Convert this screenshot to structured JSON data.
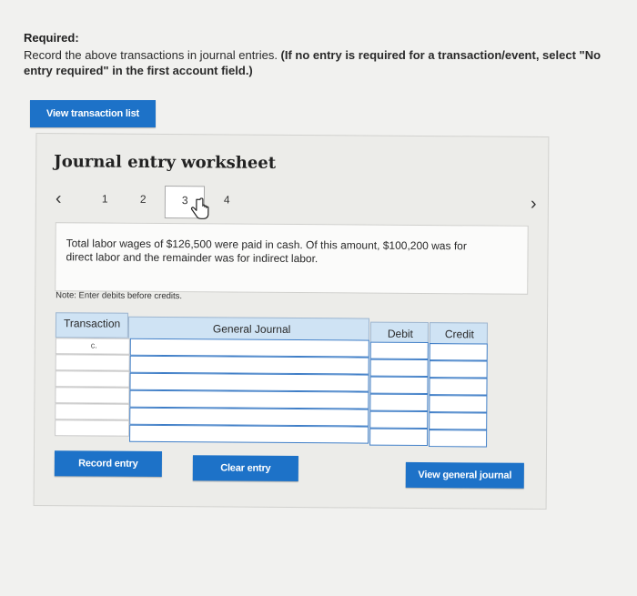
{
  "required": {
    "heading": "Required:",
    "line1_plain": "Record the above transactions in journal entries. ",
    "line1_bold": "(If no entry is required for a transaction/event, select \"No",
    "line2_bold": "entry required\" in the first account field.)"
  },
  "buttons": {
    "view_transaction_list": "View transaction list",
    "record_entry": "Record entry",
    "clear_entry": "Clear entry",
    "view_general_journal": "View general journal"
  },
  "worksheet": {
    "title": "Journal entry worksheet",
    "pager": {
      "prev_icon": "chevron-left-icon",
      "next_icon": "chevron-right-icon",
      "pages": [
        "1",
        "2",
        "3",
        "4"
      ],
      "active_page": "3"
    },
    "description": "Total labor wages of $126,500 were paid in cash. Of this amount, $100,200 was for direct labor and the remainder was for indirect labor.",
    "note": "Note: Enter debits before credits.",
    "table": {
      "headers": {
        "transaction": "Transaction",
        "general_journal": "General Journal",
        "debit": "Debit",
        "credit": "Credit"
      },
      "rows": [
        {
          "transaction": "c.",
          "account": "",
          "debit": "",
          "credit": ""
        },
        {
          "transaction": "",
          "account": "",
          "debit": "",
          "credit": ""
        },
        {
          "transaction": "",
          "account": "",
          "debit": "",
          "credit": ""
        },
        {
          "transaction": "",
          "account": "",
          "debit": "",
          "credit": ""
        },
        {
          "transaction": "",
          "account": "",
          "debit": "",
          "credit": ""
        },
        {
          "transaction": "",
          "account": "",
          "debit": "",
          "credit": ""
        }
      ]
    }
  },
  "colors": {
    "button_blue": "#1d72c8",
    "header_blue": "#cfe3f4",
    "input_border_blue": "#3f7ec7"
  }
}
